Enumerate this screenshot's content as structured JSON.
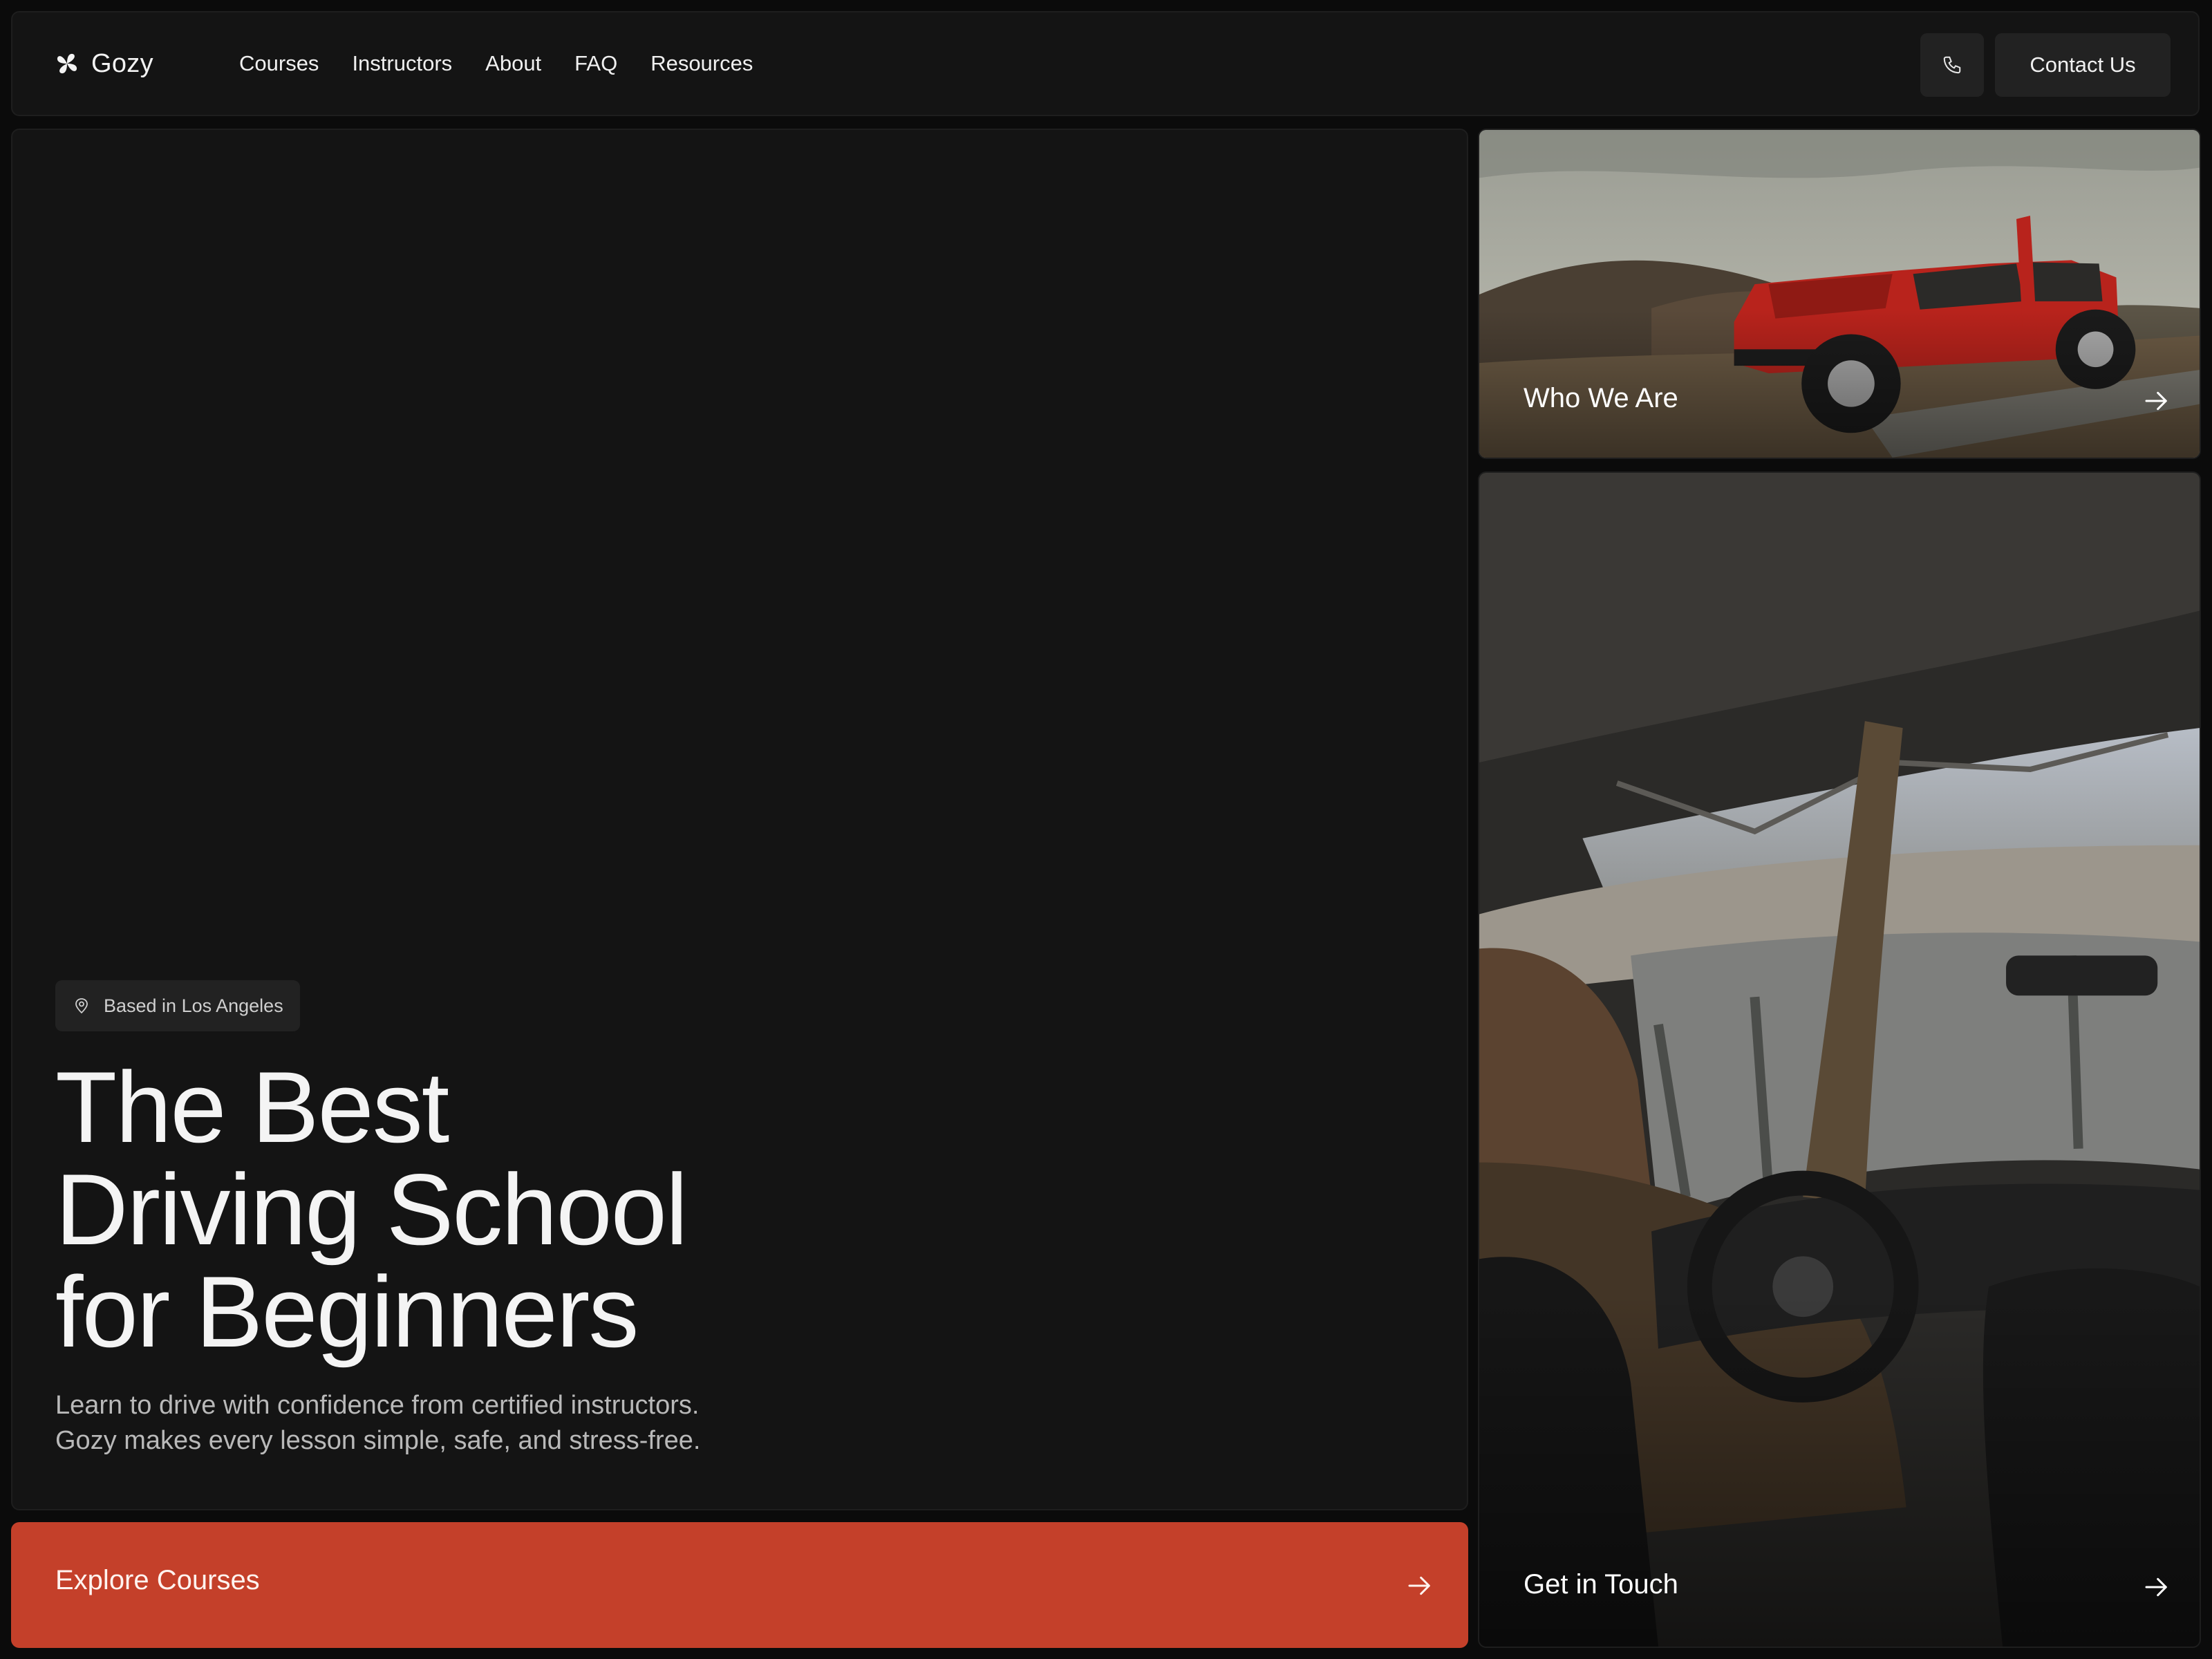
{
  "brand": {
    "name": "Gozy",
    "logo_icon": "flower-logo-icon"
  },
  "nav": {
    "items": [
      "Courses",
      "Instructors",
      "About",
      "FAQ",
      "Resources"
    ],
    "phone_icon": "phone-icon",
    "contact_label": "Contact Us"
  },
  "hero": {
    "badge_icon": "map-pin-icon",
    "badge": "Based in Los Angeles",
    "headline": [
      "The Best",
      "Driving School",
      "for Beginners"
    ],
    "subtext": [
      "Learn to drive with confidence from certified instructors.",
      "Gozy makes every lesson simple, safe, and stress-free."
    ]
  },
  "cta": {
    "label": "Explore Courses",
    "icon": "arrow-right-icon"
  },
  "cards": {
    "about": {
      "label": "Who We Are",
      "icon": "arrow-right-icon",
      "image": "red-jeep-photo"
    },
    "touch": {
      "label": "Get in Touch",
      "icon": "arrow-right-icon",
      "image": "car-interior-photo"
    }
  },
  "colors": {
    "background": "#0b0b0b",
    "panel": "#141414",
    "button": "#222222",
    "accent": "#c4402a",
    "text": "#f4f4f4",
    "muted": "#b9b9b9"
  }
}
